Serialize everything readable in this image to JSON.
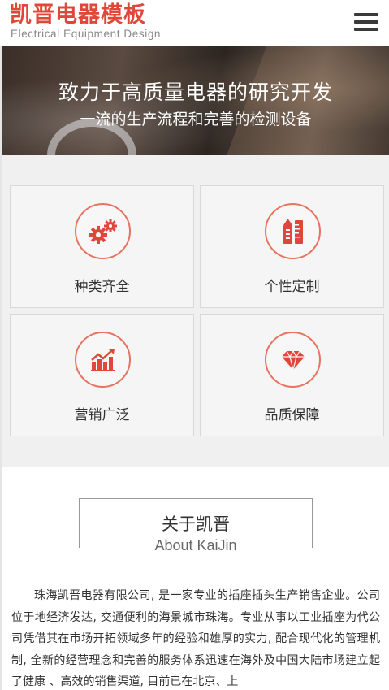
{
  "header": {
    "logo_cn": "凯晋电器模板",
    "logo_en": "Electrical Equipment Design",
    "menu_icon": "hamburger-menu-icon"
  },
  "banner": {
    "title": "致力于高质量电器的研究开发",
    "subtitle": "一流的生产流程和完善的检测设备"
  },
  "features": [
    {
      "label": "种类齐全",
      "icon": "gears-icon"
    },
    {
      "label": "个性定制",
      "icon": "tools-icon"
    },
    {
      "label": "营销广泛",
      "icon": "growth-chart-icon"
    },
    {
      "label": "品质保障",
      "icon": "diamond-icon"
    }
  ],
  "about": {
    "title_cn": "关于凯晋",
    "title_en": "About KaiJin",
    "text": "珠海凯晋电器有限公司, 是一家专业的插座插头生产销售企业。公司位于地经济发达, 交通便利的海景城市珠海。专业从事以工业插座为代公司凭借其在市场开拓领域多年的经验和雄厚的实力, 配合现代化的管理机制, 全新的经营理念和完善的服务体系迅速在海外及中国大陆市场建立起了健康 、高效的销售渠道, 目前已在北京、上"
  },
  "colors": {
    "accent": "#e0473a",
    "icon_ring": "#e8725f",
    "panel_bg": "#f0f0f0"
  }
}
